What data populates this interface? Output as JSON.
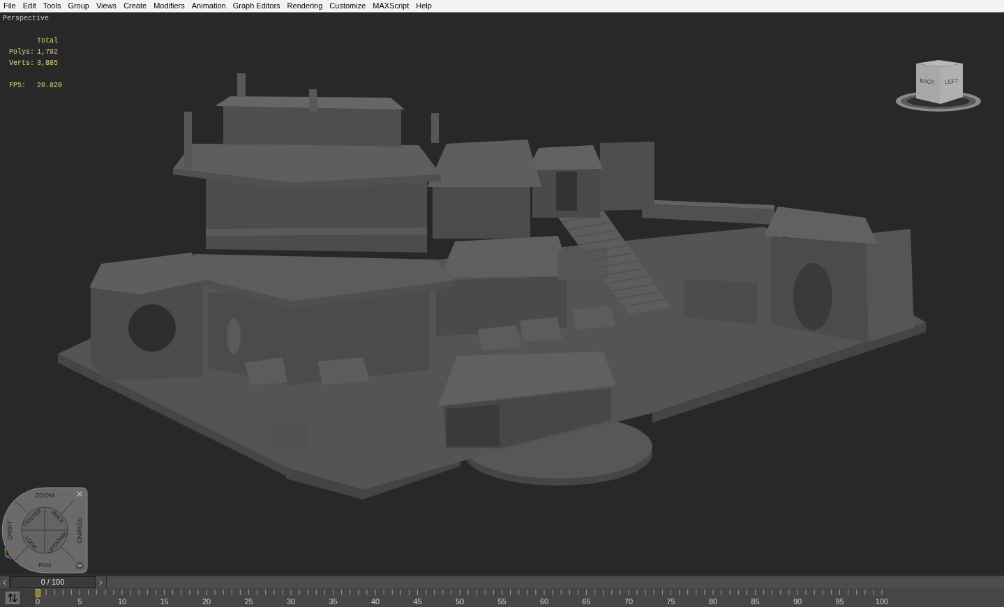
{
  "menu_bar": {
    "items": [
      "File",
      "Edit",
      "Tools",
      "Group",
      "Views",
      "Create",
      "Modifiers",
      "Animation",
      "Graph Editors",
      "Rendering",
      "Customize",
      "MAXScript",
      "Help"
    ]
  },
  "viewport": {
    "label": "Perspective",
    "stats": {
      "header": "Total",
      "rows": [
        {
          "label": "Polys:",
          "value": "1,792"
        },
        {
          "label": "Verts:",
          "value": "3,885"
        }
      ],
      "fps": {
        "label": "FPS:",
        "value": "20.820"
      }
    },
    "view_cube": {
      "faces": [
        "BACK",
        "LEFT"
      ]
    },
    "steering_wheel": {
      "outer": [
        "ZOOM",
        "ORBIT",
        "REWIND",
        "PAN"
      ],
      "inner": [
        "CENTER",
        "WALK",
        "LOOK",
        "UP/DOWN"
      ]
    }
  },
  "time_slider": {
    "readout": "0 / 100",
    "level": 0
  },
  "track_bar": {
    "labels": [
      "0",
      "5",
      "10",
      "15",
      "20",
      "25",
      "30",
      "35",
      "40",
      "45",
      "50",
      "55",
      "60",
      "65",
      "70",
      "75",
      "80",
      "85",
      "90",
      "95",
      "100"
    ]
  }
}
